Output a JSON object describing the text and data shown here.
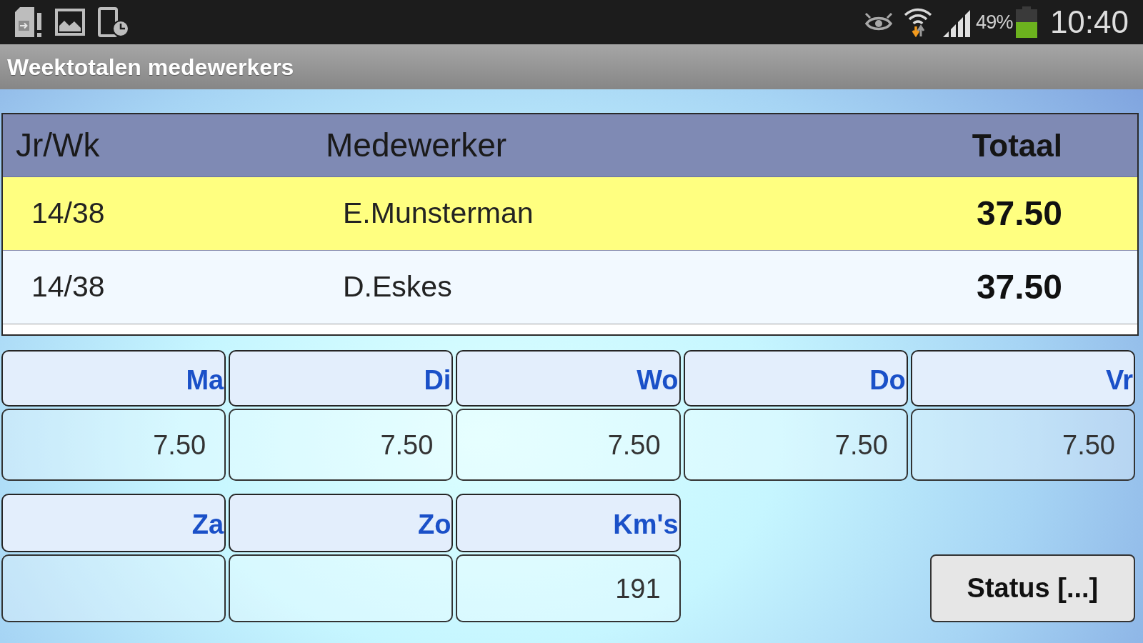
{
  "status_bar": {
    "battery_text": "49%",
    "time": "10:40"
  },
  "title_bar": {
    "title": "Weektotalen medewerkers"
  },
  "table": {
    "columns": [
      "Jr/Wk",
      "Medewerker",
      "Totaal"
    ],
    "rows": [
      {
        "cells": [
          "14/38",
          "E.Munsterman",
          "37.50"
        ],
        "selected": true
      },
      {
        "cells": [
          "14/38",
          "D.Eskes",
          "37.50"
        ],
        "selected": false
      }
    ]
  },
  "day_fields": [
    {
      "label": "Ma",
      "value": "7.50"
    },
    {
      "label": "Di",
      "value": "7.50"
    },
    {
      "label": "Wo",
      "value": "7.50"
    },
    {
      "label": "Do",
      "value": "7.50"
    },
    {
      "label": "Vr",
      "value": "7.50"
    }
  ],
  "extra_fields": [
    {
      "label": "Za"
    },
    {
      "label": "Zo"
    },
    {
      "label": "Km's",
      "value": "191"
    }
  ],
  "buttons": [
    {
      "label": "Status [...]"
    }
  ]
}
